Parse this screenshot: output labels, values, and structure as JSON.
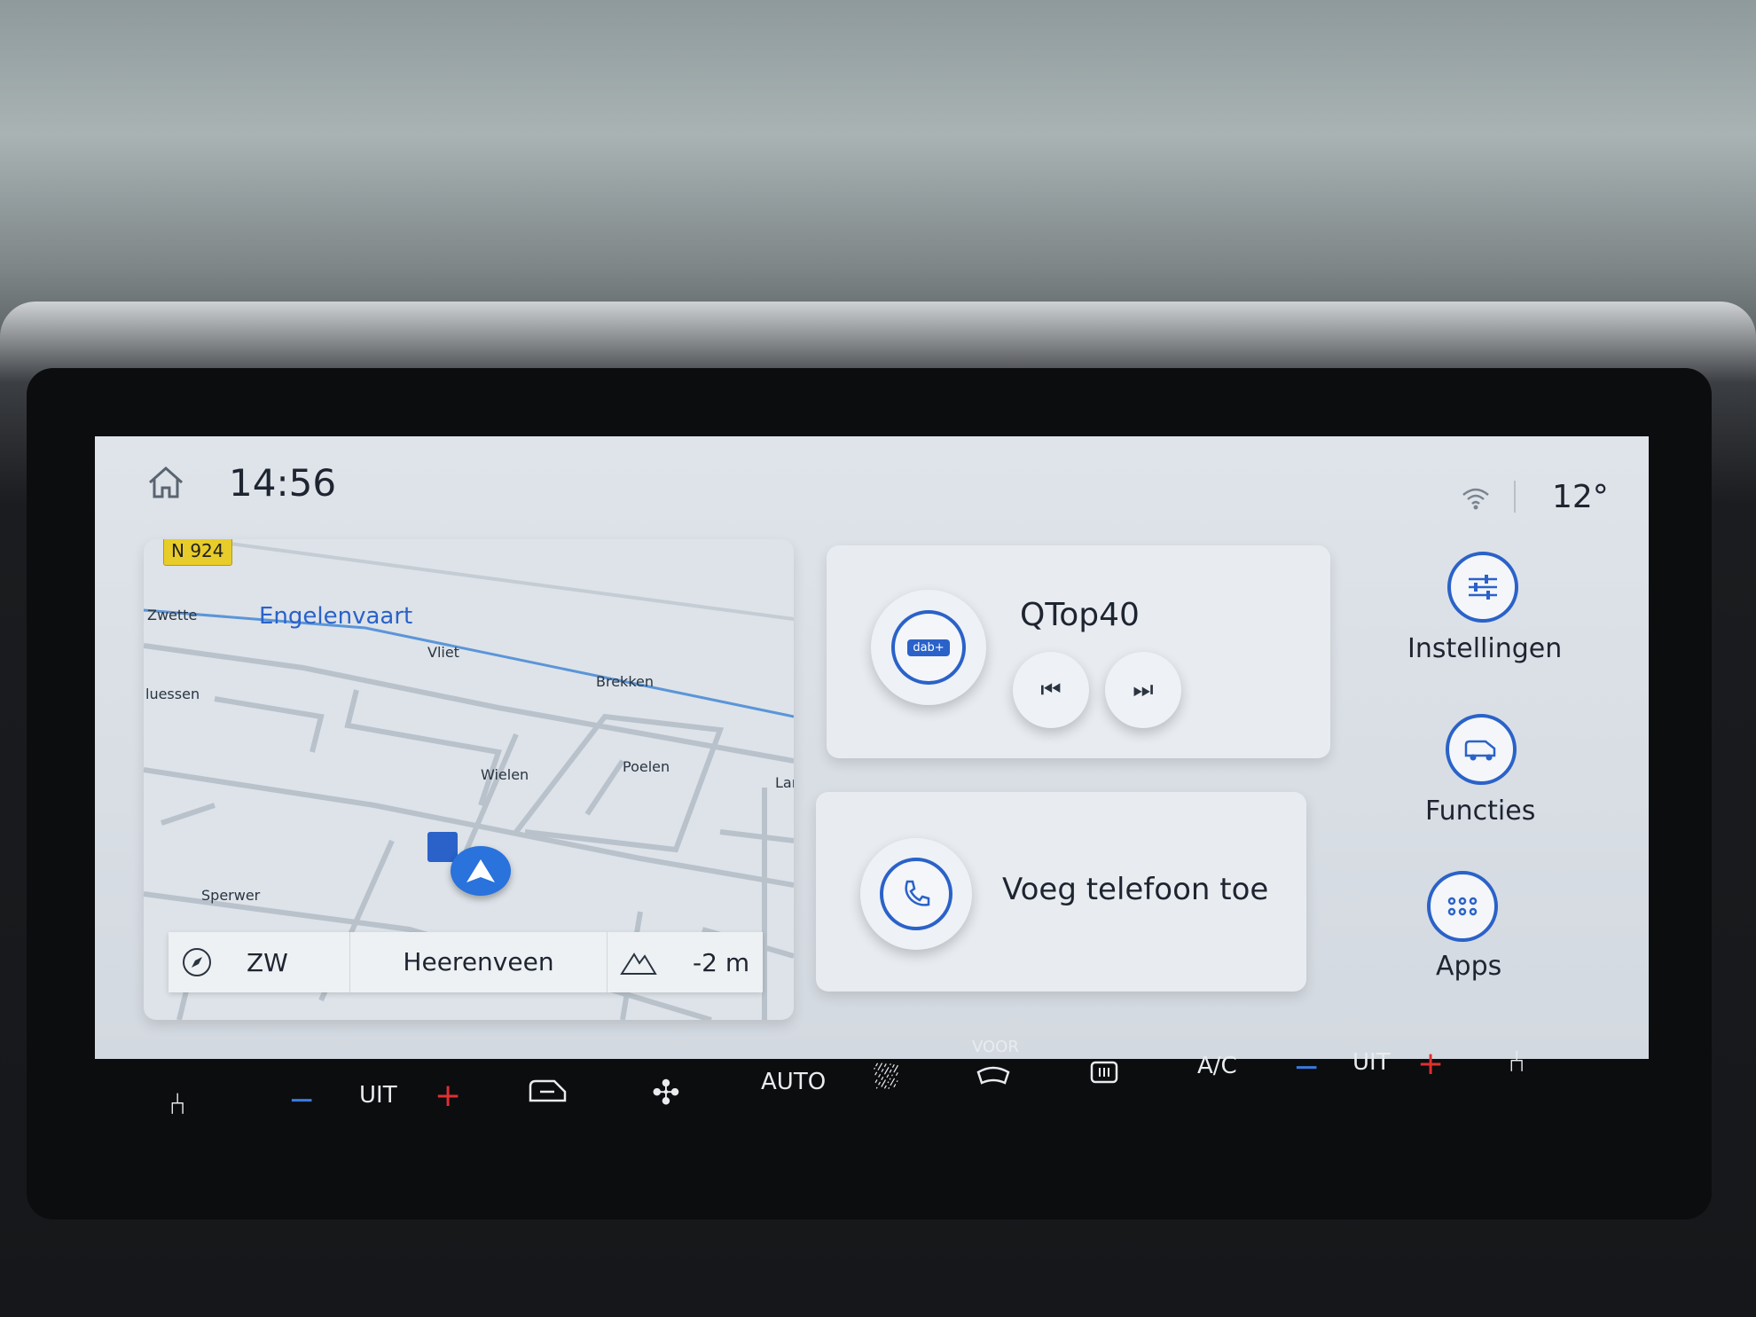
{
  "status_bar": {
    "time": "14:56",
    "temperature": "12°",
    "icons": [
      "home-icon",
      "wifi-icon"
    ]
  },
  "map": {
    "road_badge": "N 924",
    "street_name": "Engelenvaart",
    "places": [
      "Zwette",
      "Vliet",
      "Brekken",
      "luessen",
      "Wielen",
      "Poelen",
      "Lar",
      "Sperwer"
    ],
    "footer": {
      "heading": "ZW",
      "city": "Heerenveen",
      "altitude": "-2 m"
    },
    "colors": {
      "accent": "#2a62c9",
      "badge": "#e8cc2a"
    }
  },
  "media": {
    "station": "QTop40",
    "source_icon": "dab-radio-icon",
    "prev_icon": "skip-previous-icon",
    "next_icon": "skip-next-icon"
  },
  "phone": {
    "label": "Voeg telefoon toe"
  },
  "shortcuts": [
    {
      "label": "Instellingen",
      "icon": "settings-sliders-icon"
    },
    {
      "label": "Functies",
      "icon": "van-icon"
    },
    {
      "label": "Apps",
      "icon": "apps-grid-icon"
    }
  ],
  "climate": {
    "left_temp": "UIT",
    "auto": "AUTO",
    "front_label": "VOOR",
    "ac": "A/C",
    "right_temp": "UIT",
    "minus": "−",
    "plus": "+"
  }
}
